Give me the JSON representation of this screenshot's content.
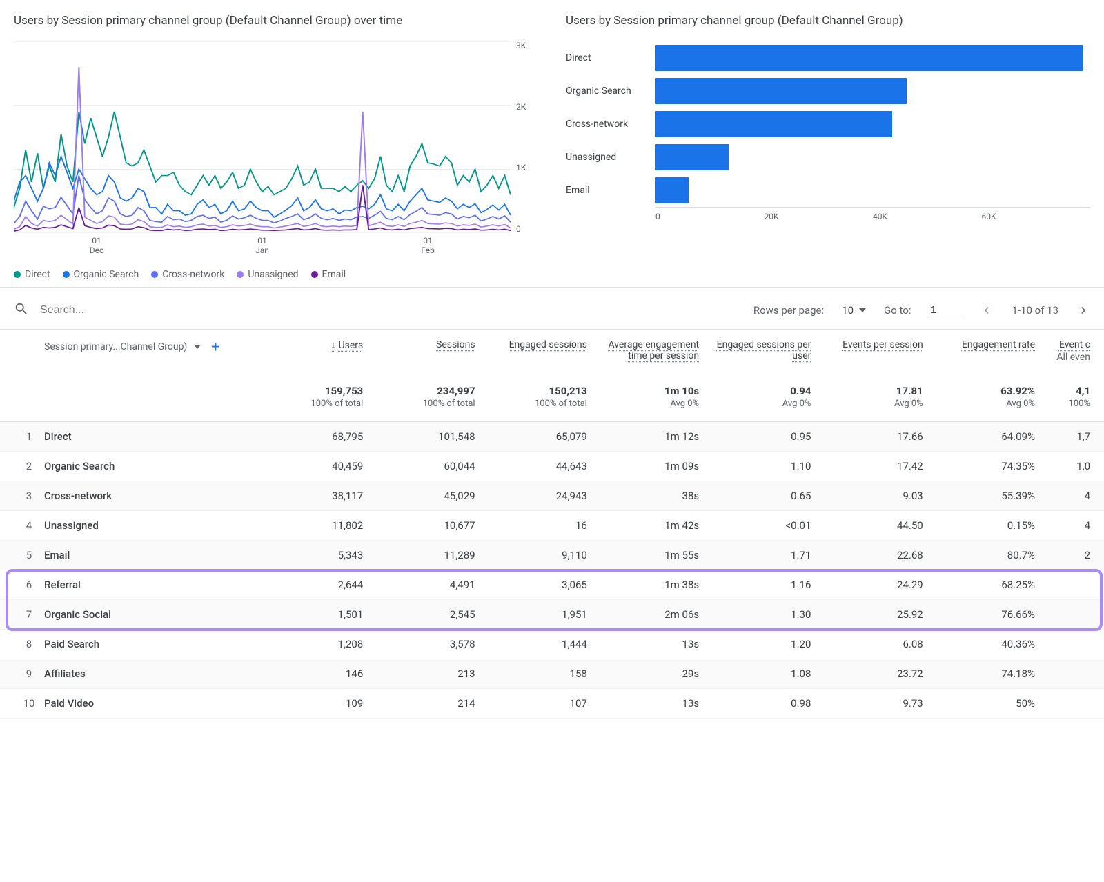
{
  "chart_data": [
    {
      "type": "line",
      "title": "Users by Session primary channel group (Default Channel Group) over time",
      "ylabel": "",
      "ylim": [
        0,
        3000
      ],
      "y_ticks": [
        "3K",
        "2K",
        "1K",
        "0"
      ],
      "x_ticks": [
        {
          "top": "01",
          "bottom": "Dec"
        },
        {
          "top": "01",
          "bottom": "Jan"
        },
        {
          "top": "01",
          "bottom": "Feb"
        }
      ],
      "legend": [
        {
          "name": "Direct",
          "color": "#009688"
        },
        {
          "name": "Organic Search",
          "color": "#1a73e8"
        },
        {
          "name": "Cross-network",
          "color": "#5e6cf0"
        },
        {
          "name": "Unassigned",
          "color": "#9c7cf4"
        },
        {
          "name": "Email",
          "color": "#6a1b9a"
        }
      ],
      "x": [
        0,
        1,
        2,
        3,
        4,
        5,
        6,
        7,
        8,
        9,
        10,
        11,
        12,
        13,
        14,
        15,
        16,
        17,
        18,
        19,
        20,
        21,
        22,
        23,
        24,
        25,
        26,
        27,
        28,
        29,
        30,
        31,
        32,
        33,
        34,
        35,
        36,
        37,
        38,
        39,
        40,
        41,
        42,
        43,
        44,
        45,
        46,
        47,
        48,
        49,
        50,
        51,
        52,
        53,
        54,
        55,
        56,
        57,
        58,
        59,
        60,
        61,
        62,
        63,
        64,
        65,
        66,
        67,
        68,
        69,
        70,
        71,
        72,
        73,
        74,
        75,
        76,
        77,
        78,
        79,
        80,
        81,
        82,
        83,
        84
      ],
      "series": [
        {
          "name": "Direct",
          "color": "#009688",
          "values": [
            400,
            700,
            1300,
            800,
            1250,
            700,
            1050,
            800,
            1550,
            1050,
            800,
            1900,
            1400,
            1800,
            1500,
            1200,
            1500,
            1900,
            1500,
            1100,
            1050,
            1100,
            1300,
            1050,
            800,
            900,
            900,
            950,
            750,
            650,
            600,
            750,
            900,
            750,
            900,
            700,
            800,
            950,
            700,
            750,
            1000,
            800,
            650,
            730,
            600,
            650,
            700,
            850,
            1050,
            750,
            800,
            1000,
            700,
            700,
            700,
            650,
            730,
            650,
            750,
            820,
            700,
            850,
            1200,
            750,
            650,
            900,
            650,
            1050,
            1200,
            1400,
            1100,
            1080,
            1050,
            1200,
            1100,
            750,
            900,
            800,
            1000,
            650,
            750,
            900,
            700,
            900,
            600
          ]
        },
        {
          "name": "Organic Search",
          "color": "#1a73e8",
          "values": [
            500,
            800,
            900,
            700,
            500,
            700,
            1100,
            900,
            1200,
            950,
            700,
            1000,
            850,
            700,
            600,
            650,
            900,
            800,
            550,
            500,
            550,
            700,
            650,
            400,
            400,
            300,
            450,
            350,
            350,
            280,
            300,
            450,
            520,
            400,
            450,
            300,
            350,
            500,
            350,
            380,
            500,
            400,
            350,
            350,
            250,
            300,
            360,
            430,
            550,
            350,
            400,
            520,
            380,
            350,
            380,
            300,
            360,
            350,
            400,
            420,
            380,
            450,
            600,
            380,
            350,
            450,
            350,
            500,
            600,
            700,
            520,
            500,
            480,
            550,
            500,
            380,
            450,
            400,
            460,
            320,
            370,
            440,
            360,
            450,
            280
          ]
        },
        {
          "name": "Cross-network",
          "color": "#5e6cf0",
          "values": [
            150,
            260,
            500,
            350,
            220,
            420,
            380,
            400,
            560,
            430,
            300,
            900,
            520,
            400,
            300,
            350,
            550,
            500,
            300,
            260,
            280,
            400,
            350,
            200,
            180,
            170,
            260,
            210,
            220,
            180,
            200,
            260,
            280,
            230,
            250,
            170,
            200,
            270,
            220,
            240,
            280,
            230,
            200,
            200,
            160,
            190,
            230,
            260,
            300,
            210,
            240,
            300,
            230,
            210,
            230,
            200,
            220,
            210,
            250,
            260,
            230,
            280,
            340,
            230,
            210,
            260,
            210,
            290,
            340,
            400,
            300,
            290,
            280,
            320,
            300,
            220,
            260,
            240,
            280,
            190,
            220,
            260,
            220,
            270,
            170
          ]
        },
        {
          "name": "Unassigned",
          "color": "#9c7cf4",
          "values": [
            60,
            100,
            260,
            150,
            110,
            200,
            180,
            200,
            280,
            210,
            140,
            2600,
            250,
            200,
            150,
            180,
            270,
            250,
            140,
            130,
            140,
            210,
            180,
            100,
            90,
            90,
            130,
            100,
            110,
            90,
            100,
            130,
            140,
            110,
            120,
            90,
            100,
            130,
            110,
            120,
            140,
            110,
            100,
            100,
            80,
            95,
            110,
            130,
            150,
            105,
            120,
            150,
            110,
            100,
            110,
            100,
            110,
            105,
            120,
            1900,
            115,
            140,
            170,
            115,
            105,
            130,
            105,
            150,
            170,
            200,
            150,
            145,
            140,
            160,
            150,
            110,
            130,
            120,
            140,
            95,
            110,
            130,
            110,
            135,
            80
          ]
        },
        {
          "name": "Email",
          "color": "#6a1b9a",
          "values": [
            30,
            50,
            120,
            80,
            60,
            90,
            80,
            90,
            130,
            100,
            70,
            400,
            115,
            90,
            70,
            80,
            125,
            115,
            65,
            60,
            65,
            100,
            85,
            45,
            40,
            40,
            60,
            50,
            55,
            40,
            45,
            60,
            65,
            55,
            60,
            40,
            45,
            60,
            50,
            55,
            65,
            55,
            45,
            45,
            40,
            45,
            50,
            60,
            70,
            50,
            55,
            70,
            50,
            45,
            50,
            45,
            50,
            50,
            55,
            750,
            55,
            65,
            80,
            55,
            50,
            60,
            50,
            70,
            80,
            90,
            70,
            68,
            65,
            75,
            70,
            50,
            60,
            55,
            65,
            45,
            50,
            60,
            50,
            62,
            40
          ]
        }
      ]
    },
    {
      "type": "bar",
      "title": "Users by Session primary channel group (Default Channel Group)",
      "categories": [
        "Direct",
        "Organic Search",
        "Cross-network",
        "Unassigned",
        "Email"
      ],
      "values": [
        68795,
        40459,
        38117,
        11802,
        5343
      ],
      "xlim": [
        0,
        70000
      ],
      "x_ticks": [
        "0",
        "20K",
        "40K",
        "60K"
      ],
      "color": "#1a73e8"
    }
  ],
  "search": {
    "placeholder": "Search..."
  },
  "pager": {
    "rows_label": "Rows per page:",
    "rows_value": "10",
    "goto_label": "Go to:",
    "goto_value": "1",
    "range": "1-10 of 13"
  },
  "table": {
    "dimension_label": "Session primary...Channel Group)",
    "sort_arrow": "↓",
    "headers": [
      "Users",
      "Sessions",
      "Engaged sessions",
      "Average engagement time per session",
      "Engaged sessions per user",
      "Events per session",
      "Engagement rate"
    ],
    "header_partial": {
      "line1": "Event c",
      "line2": "All even"
    },
    "totals": {
      "values": [
        "159,753",
        "234,997",
        "150,213",
        "1m 10s",
        "0.94",
        "17.81",
        "63.92%"
      ],
      "subs": [
        "100% of total",
        "100% of total",
        "100% of total",
        "Avg 0%",
        "Avg 0%",
        "Avg 0%",
        "Avg 0%"
      ],
      "partial": {
        "v": "4,1",
        "s": "100%"
      }
    },
    "rows": [
      {
        "idx": "1",
        "name": "Direct",
        "cells": [
          "68,795",
          "101,548",
          "65,079",
          "1m 12s",
          "0.95",
          "17.66",
          "64.09%"
        ],
        "partial": "1,7"
      },
      {
        "idx": "2",
        "name": "Organic Search",
        "cells": [
          "40,459",
          "60,044",
          "44,643",
          "1m 09s",
          "1.10",
          "17.42",
          "74.35%"
        ],
        "partial": "1,0"
      },
      {
        "idx": "3",
        "name": "Cross-network",
        "cells": [
          "38,117",
          "45,029",
          "24,943",
          "38s",
          "0.65",
          "9.03",
          "55.39%"
        ],
        "partial": "4"
      },
      {
        "idx": "4",
        "name": "Unassigned",
        "cells": [
          "11,802",
          "10,677",
          "16",
          "1m 42s",
          "<0.01",
          "44.50",
          "0.15%"
        ],
        "partial": "4"
      },
      {
        "idx": "5",
        "name": "Email",
        "cells": [
          "5,343",
          "11,289",
          "9,110",
          "1m 55s",
          "1.71",
          "22.68",
          "80.7%"
        ],
        "partial": "2"
      },
      {
        "idx": "6",
        "name": "Referral",
        "cells": [
          "2,644",
          "4,491",
          "3,065",
          "1m 38s",
          "1.16",
          "24.29",
          "68.25%"
        ],
        "partial": ""
      },
      {
        "idx": "7",
        "name": "Organic Social",
        "cells": [
          "1,501",
          "2,545",
          "1,951",
          "2m 06s",
          "1.30",
          "25.92",
          "76.66%"
        ],
        "partial": ""
      },
      {
        "idx": "8",
        "name": "Paid Search",
        "cells": [
          "1,208",
          "3,578",
          "1,444",
          "13s",
          "1.20",
          "6.08",
          "40.36%"
        ],
        "partial": ""
      },
      {
        "idx": "9",
        "name": "Affiliates",
        "cells": [
          "146",
          "213",
          "158",
          "29s",
          "1.08",
          "23.72",
          "74.18%"
        ],
        "partial": ""
      },
      {
        "idx": "10",
        "name": "Paid Video",
        "cells": [
          "109",
          "214",
          "107",
          "13s",
          "0.98",
          "9.73",
          "50%"
        ],
        "partial": ""
      }
    ],
    "highlight_rows": [
      6,
      7
    ]
  }
}
